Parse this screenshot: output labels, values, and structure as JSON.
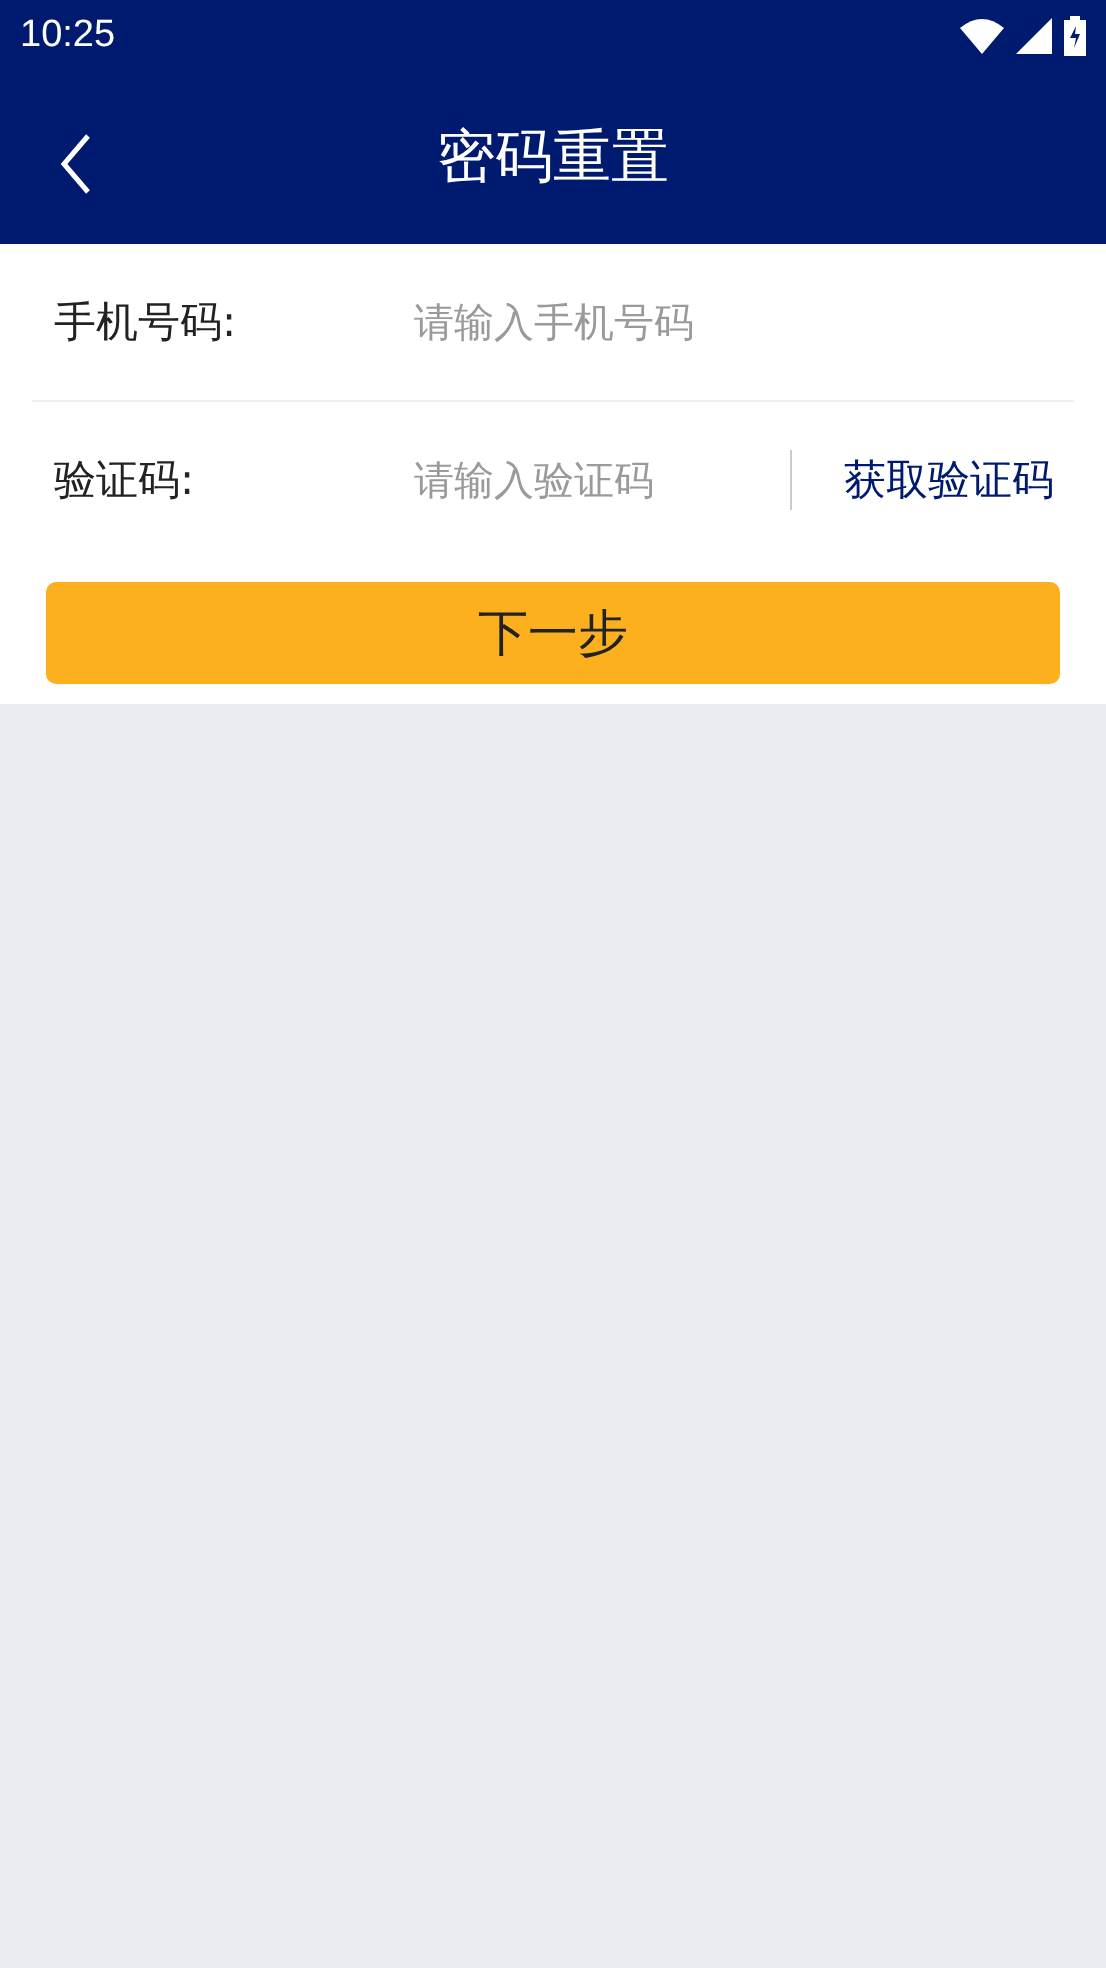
{
  "status_bar": {
    "time": "10:25"
  },
  "header": {
    "title": "密码重置"
  },
  "fields": [
    {
      "label": "手机号码:",
      "placeholder": "请输入手机号码",
      "kind": "plain"
    },
    {
      "label": "验证码:",
      "placeholder": "请输入验证码",
      "kind": "code",
      "action": "获取验证码"
    }
  ],
  "next_button": "下一步"
}
